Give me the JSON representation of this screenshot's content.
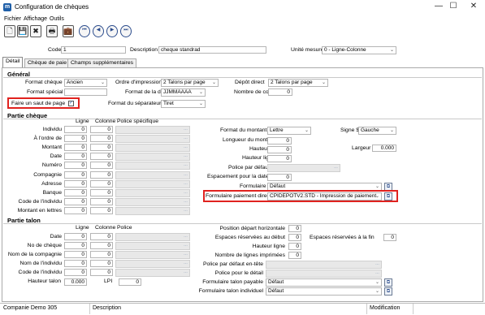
{
  "window": {
    "title": "Configuration de chèques",
    "app_icon": "m",
    "minimize": "—",
    "maximize": "☐",
    "close": "✕"
  },
  "menu": [
    "Fichier",
    "Affichage",
    "Outils"
  ],
  "toolbar": {
    "new": "🗋",
    "save": "💾",
    "delete": "✖",
    "print": "🖶",
    "export": "💼",
    "first": "⏮",
    "prev": "◀",
    "next": "▶",
    "last": "⏭"
  },
  "header": {
    "code_label": "Code",
    "code_value": "1",
    "desc_label": "Description",
    "desc_value": "cheque standrad",
    "unit_label": "Unité mesure",
    "unit_value": "0 - Ligne-Colonne"
  },
  "tabs": [
    "Détail",
    "Chèque de paie",
    "Champs supplémentaires"
  ],
  "general": {
    "title": "Général",
    "format_cheque_label": "Format chèque",
    "format_cheque_value": "Ancien",
    "ordre_label": "Ordre d'impression",
    "ordre_value": "2 Talons par page",
    "depot_label": "Dépôt direct",
    "depot_value": "2 Talons par page",
    "format_special_label": "Format spécial",
    "format_date_label": "Format de la date",
    "format_date_value": "JJMMAAAA",
    "copies_label": "Nombre de copies",
    "copies_value": "0",
    "saut_label": "Faire un saut de page",
    "saut_check": "✓",
    "separateur_label": "Format du séparateur",
    "separateur_value": "Tiret"
  },
  "partie_cheque": {
    "title": "Partie chèque",
    "col_ligne": "Ligne",
    "col_colonne": "Colonne",
    "col_police": "Police spécifique",
    "rows": [
      {
        "label": "Individu",
        "l": "0",
        "c": "0"
      },
      {
        "label": "À l'ordre de",
        "l": "0",
        "c": "0"
      },
      {
        "label": "Montant",
        "l": "0",
        "c": "0"
      },
      {
        "label": "Date",
        "l": "0",
        "c": "0"
      },
      {
        "label": "Numéro",
        "l": "0",
        "c": "0"
      },
      {
        "label": "Compagnie",
        "l": "0",
        "c": "0"
      },
      {
        "label": "Adresse",
        "l": "0",
        "c": "0"
      },
      {
        "label": "Banque",
        "l": "0",
        "c": "0"
      },
      {
        "label": "Code de l'individu",
        "l": "0",
        "c": "0"
      },
      {
        "label": "Montant en lettres",
        "l": "0",
        "c": "0"
      }
    ],
    "format_montant_label": "Format du montant",
    "format_montant_value": "Lettre",
    "signe_label": "Signe $",
    "signe_value": "Gauche",
    "longueur_label": "Longueur du montant",
    "longueur_value": "0",
    "hauteur_label": "Hauteur",
    "hauteur_value": "0",
    "largeur_label": "Largeur",
    "largeur_value": "0.000",
    "hauteur_ligne_label": "Hauteur ligne",
    "hauteur_ligne_value": "0",
    "police_defaut_label": "Police par défaut",
    "espacement_label": "Espacement pour la date",
    "espacement_value": "0",
    "formulaire_label": "Formulaire",
    "formulaire_value": "Défaut",
    "formulaire_pd_label": "Formulaire paiement direct",
    "formulaire_pd_value": "CPIDEPOTV2.STD - Impression de paiement"
  },
  "partie_talon": {
    "title": "Partie talon",
    "col_ligne": "Ligne",
    "col_colonne": "Colonne",
    "col_police": "Police",
    "rows": [
      {
        "label": "Date",
        "l": "0",
        "c": "0"
      },
      {
        "label": "No de chèque",
        "l": "0",
        "c": "0"
      },
      {
        "label": "Nom de la compagnie",
        "l": "0",
        "c": "0"
      },
      {
        "label": "Nom de l'individu",
        "l": "0",
        "c": "0"
      },
      {
        "label": "Code de l'individu",
        "l": "0",
        "c": "0"
      }
    ],
    "hauteur_talon_label": "Hauteur talon",
    "hauteur_talon_value": "0.000",
    "lpi_label": "LPI",
    "lpi_value": "0",
    "position_label": "Position départ horizontale",
    "position_value": "0",
    "espaces_debut_label": "Espaces réservées au début",
    "espaces_debut_value": "0",
    "espaces_fin_label": "Espaces réservées à la fin",
    "espaces_fin_value": "0",
    "hauteur_ligne_label": "Hauteur ligne",
    "hauteur_ligne_value": "0",
    "nb_lignes_label": "Nombre de lignes imprimées",
    "nb_lignes_value": "0",
    "police_entete_label": "Police par défaut en-tête",
    "police_detail_label": "Police pour le détail",
    "ftp_label": "Formulaire talon payable",
    "ftp_value": "Défaut",
    "fti_label": "Formulaire talon individuel",
    "fti_value": "Défaut"
  },
  "status": {
    "company": "Companie Demo 305",
    "description": "Description",
    "modification": "Modification"
  },
  "colors": {
    "accent": "#1f5fa8",
    "highlight": "#e0221f"
  }
}
